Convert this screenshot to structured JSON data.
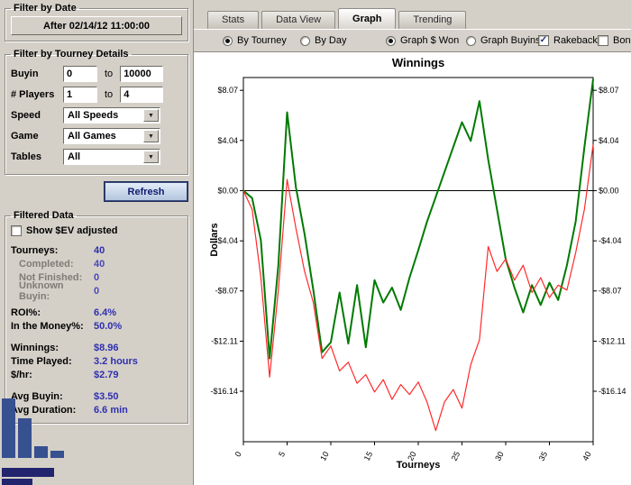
{
  "window": {
    "bg": "#d4d0c8",
    "value_blue": "#2f2fb0"
  },
  "sidebar": {
    "date_group": {
      "title": "Filter by Date",
      "button_label": "After 02/14/12 11:00:00"
    },
    "details_group": {
      "title": "Filter by Tourney Details",
      "buyin": {
        "label": "Buyin",
        "from": "0",
        "to_label": "to",
        "to": "10000"
      },
      "players": {
        "label": "# Players",
        "from": "1",
        "to_label": "to",
        "to": "4"
      },
      "speed": {
        "label": "Speed",
        "value": "All Speeds"
      },
      "game": {
        "label": "Game",
        "value": "All Games"
      },
      "tables": {
        "label": "Tables",
        "value": "All"
      }
    },
    "refresh_label": "Refresh",
    "filtered_group": {
      "title": "Filtered Data",
      "ev_checkbox": "Show $EV adjusted",
      "stats": [
        {
          "label": "Tourneys:",
          "value": "40"
        },
        {
          "label": "Completed:",
          "value": "40"
        },
        {
          "label": "Not Finished:",
          "value": "0"
        },
        {
          "label": "Unknown Buyin:",
          "value": "0"
        },
        {
          "label": "ROI%:",
          "value": "6.4%"
        },
        {
          "label": "In the Money%:",
          "value": "50.0%"
        },
        {
          "label": "Winnings:",
          "value": "$8.96"
        },
        {
          "label": "Time Played:",
          "value": "3.2 hours"
        },
        {
          "label": "$/hr:",
          "value": "$2.79"
        },
        {
          "label": "Avg Buyin:",
          "value": "$3.50"
        },
        {
          "label": "Avg Duration:",
          "value": "6.6 min"
        }
      ]
    },
    "histogram": {
      "bar_color": "#37508f",
      "heights": [
        66,
        44,
        13,
        8
      ]
    }
  },
  "tabs": [
    {
      "label": "Stats",
      "active": false
    },
    {
      "label": "Data View",
      "active": false
    },
    {
      "label": "Graph",
      "active": true
    },
    {
      "label": "Trending",
      "active": false
    }
  ],
  "controls": {
    "radios": [
      {
        "label": "By Tourney",
        "selected": true
      },
      {
        "label": "By Day",
        "selected": false
      },
      {
        "label": "Graph $ Won",
        "selected": true
      },
      {
        "label": "Graph Buyins",
        "selected": false
      }
    ],
    "checkboxes": [
      {
        "label": "Rakeback",
        "checked": true
      },
      {
        "label": "Bonus",
        "checked": false
      }
    ]
  },
  "chart_data": {
    "type": "line",
    "title": "Winnings",
    "xlabel": "Tourneys",
    "ylabel": "Dollars",
    "xlim": [
      0,
      40
    ],
    "ylim": [
      -20.2,
      9.1
    ],
    "grid": false,
    "legend": "none",
    "zero_line": true,
    "x": [
      0,
      1,
      2,
      3,
      4,
      5,
      6,
      7,
      8,
      9,
      10,
      11,
      12,
      13,
      14,
      15,
      16,
      17,
      18,
      19,
      20,
      21,
      22,
      23,
      24,
      25,
      26,
      27,
      28,
      29,
      30,
      31,
      32,
      33,
      34,
      35,
      36,
      37,
      38,
      39,
      40
    ],
    "yticks": [
      {
        "value": 8.07,
        "label": "$8.07"
      },
      {
        "value": 4.04,
        "label": "$4.04"
      },
      {
        "value": 0,
        "label": "$0.00"
      },
      {
        "value": -4.04,
        "label": "-$4.04"
      },
      {
        "value": -8.07,
        "label": "-$8.07"
      },
      {
        "value": -12.11,
        "label": "-$12.11"
      },
      {
        "value": -16.14,
        "label": "-$16.14"
      }
    ],
    "xticks": [
      0,
      5,
      10,
      15,
      20,
      25,
      30,
      35,
      40
    ],
    "series": [
      {
        "name": "green",
        "color": "#007a00",
        "width": 2,
        "values": [
          0,
          -0.6,
          -4,
          -13.5,
          -6,
          6.3,
          0.3,
          -3.5,
          -8,
          -13,
          -12.2,
          -8.2,
          -12.3,
          -7.6,
          -12.6,
          -7.2,
          -9,
          -7.8,
          -9.6,
          -7,
          -4.8,
          -2.5,
          -0.5,
          1.5,
          3.5,
          5.5,
          4,
          7.2,
          2.5,
          -1.5,
          -5.5,
          -7.8,
          -9.8,
          -7.6,
          -9.2,
          -7.4,
          -8.8,
          -6,
          -2.5,
          3.5,
          8.96
        ]
      },
      {
        "name": "red",
        "color": "#ff2a2a",
        "width": 1.2,
        "values": [
          0,
          -1.5,
          -7,
          -15,
          -8,
          0.9,
          -3,
          -6.5,
          -9,
          -13.5,
          -12.5,
          -14.5,
          -13.8,
          -15.5,
          -14.8,
          -16.2,
          -15.2,
          -16.8,
          -15.6,
          -16.4,
          -15.4,
          -17,
          -19.3,
          -17,
          -16,
          -17.5,
          -14,
          -12,
          -4.5,
          -6.5,
          -5.5,
          -7.2,
          -6,
          -8.2,
          -7,
          -8.6,
          -7.6,
          -8,
          -5,
          -1.5,
          3.7
        ]
      }
    ]
  }
}
